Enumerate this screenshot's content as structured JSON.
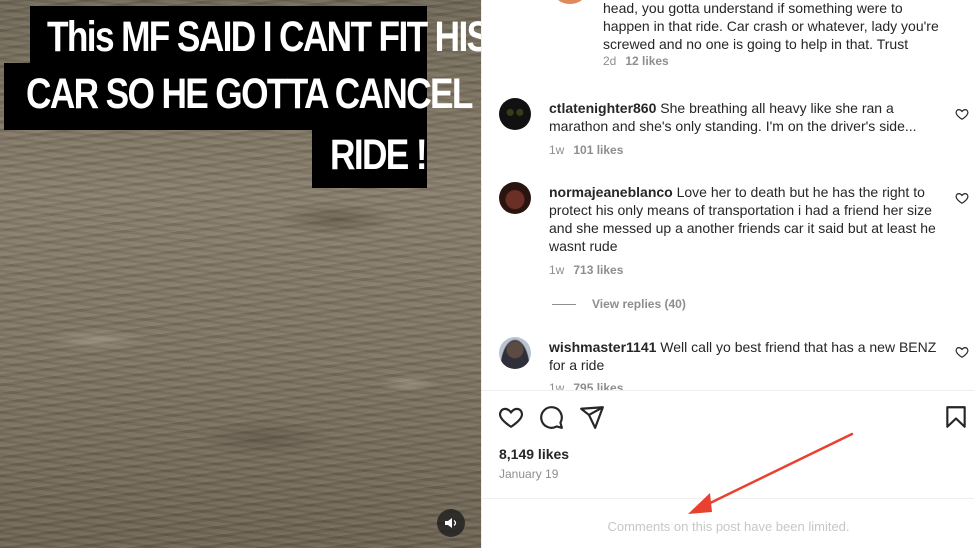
{
  "video": {
    "caption_lines": [
      "This MF SAID I CANT FIT HIS",
      "CAR SO HE  GOTTA CANCEL MY",
      "RIDE !"
    ],
    "mute_icon": "speaker-icon"
  },
  "comments": [
    {
      "username": "",
      "text": "head, you gotta understand if something were to happen in that ride. Car crash or whatever, lady you're screwed and no one is going to help in that. Trust",
      "time": "2d",
      "likes": "12 likes"
    },
    {
      "username": "ctlatenighter860",
      "text": "She breathing all heavy like she ran a marathon and she's only standing. I'm on the driver's side...",
      "time": "1w",
      "likes": "101 likes"
    },
    {
      "username": "normajeaneblanco",
      "text": "Love her to death but he has the right to protect his only means of transportation i had a friend her size and she messed up a another friends car it said but at least he wasnt rude",
      "time": "1w",
      "likes": "713 likes"
    },
    {
      "username": "wishmaster1141",
      "text": "Well call yo best friend that has a new BENZ for a ride",
      "time": "1w",
      "likes": "795 likes"
    }
  ],
  "view_replies": "View replies (40)",
  "post": {
    "likes": "8,149 likes",
    "date": "January 19",
    "comments_limited": "Comments on this post have been limited."
  },
  "colors": {
    "annotation_arrow": "#e8412f"
  }
}
